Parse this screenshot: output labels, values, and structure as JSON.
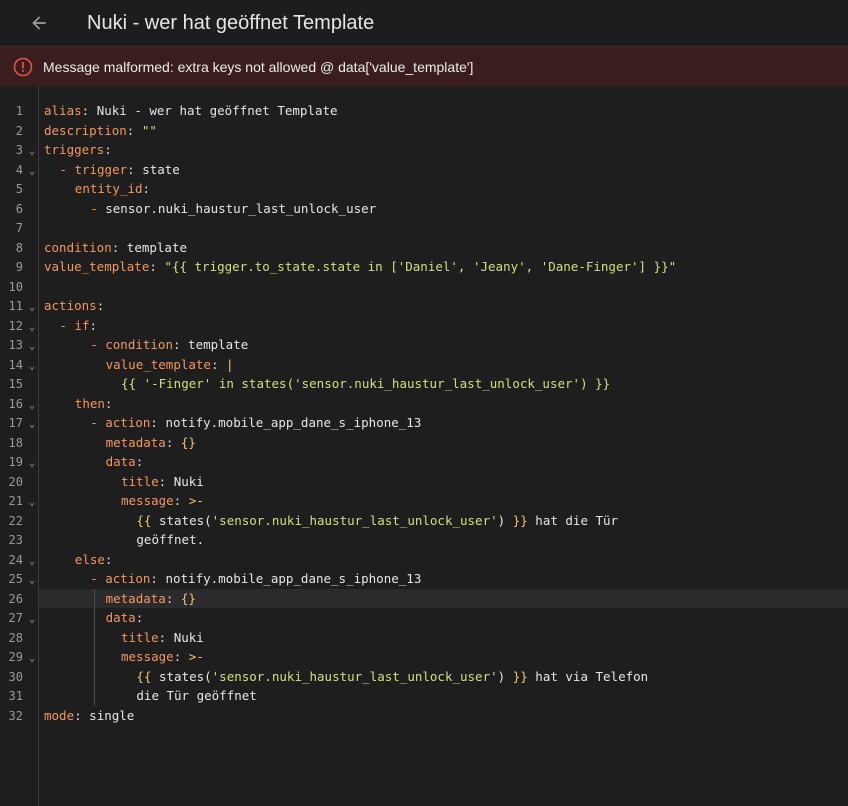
{
  "header": {
    "title": "Nuki - wer hat geöffnet Template",
    "back_icon": "arrow-left-icon"
  },
  "alert": {
    "icon": "error-circle-icon",
    "message": "Message malformed: extra keys not allowed @ data['value_template']",
    "color": "#e5533d"
  },
  "editor": {
    "active_line": 26,
    "lines": [
      {
        "n": "1",
        "fold": false,
        "indent": 0,
        "parts": [
          [
            "k",
            "alias"
          ],
          [
            "p",
            ": "
          ],
          [
            "v",
            "Nuki - wer hat geöffnet Template"
          ]
        ]
      },
      {
        "n": "2",
        "fold": false,
        "indent": 0,
        "parts": [
          [
            "k",
            "description"
          ],
          [
            "p",
            ": "
          ],
          [
            "s",
            "\"\""
          ]
        ]
      },
      {
        "n": "3",
        "fold": true,
        "indent": 0,
        "parts": [
          [
            "k",
            "triggers"
          ],
          [
            "p",
            ":"
          ]
        ]
      },
      {
        "n": "4",
        "fold": true,
        "indent": 2,
        "parts": [
          [
            "k",
            "- trigger"
          ],
          [
            "p",
            ": "
          ],
          [
            "v",
            "state"
          ]
        ]
      },
      {
        "n": "5",
        "fold": false,
        "indent": 4,
        "parts": [
          [
            "k",
            "entity_id"
          ],
          [
            "p",
            ":"
          ]
        ]
      },
      {
        "n": "6",
        "fold": false,
        "indent": 6,
        "parts": [
          [
            "k",
            "- "
          ],
          [
            "v",
            "sensor.nuki_haustur_last_unlock_user"
          ]
        ]
      },
      {
        "n": "7",
        "fold": false,
        "indent": 0,
        "parts": []
      },
      {
        "n": "8",
        "fold": false,
        "indent": 0,
        "parts": [
          [
            "k",
            "condition"
          ],
          [
            "p",
            ": "
          ],
          [
            "v",
            "template"
          ]
        ]
      },
      {
        "n": "9",
        "fold": false,
        "indent": 0,
        "parts": [
          [
            "k",
            "value_template"
          ],
          [
            "p",
            ": "
          ],
          [
            "s",
            "\"{{ trigger.to_state.state in ['Daniel', 'Jeany', 'Dane-Finger'] }}\""
          ]
        ]
      },
      {
        "n": "10",
        "fold": false,
        "indent": 0,
        "parts": []
      },
      {
        "n": "11",
        "fold": true,
        "indent": 0,
        "parts": [
          [
            "k",
            "actions"
          ],
          [
            "p",
            ":"
          ]
        ]
      },
      {
        "n": "12",
        "fold": true,
        "indent": 2,
        "parts": [
          [
            "k",
            "- if"
          ],
          [
            "p",
            ":"
          ]
        ]
      },
      {
        "n": "13",
        "fold": true,
        "indent": 6,
        "parts": [
          [
            "k",
            "- condition"
          ],
          [
            "p",
            ": "
          ],
          [
            "v",
            "template"
          ]
        ]
      },
      {
        "n": "14",
        "fold": true,
        "indent": 8,
        "parts": [
          [
            "k",
            "value_template"
          ],
          [
            "p",
            ": "
          ],
          [
            "y",
            "|"
          ]
        ]
      },
      {
        "n": "15",
        "fold": false,
        "indent": 10,
        "parts": [
          [
            "s",
            "{{ '-Finger' in states('sensor.nuki_haustur_last_unlock_user') }}"
          ]
        ]
      },
      {
        "n": "16",
        "fold": true,
        "indent": 4,
        "parts": [
          [
            "k",
            "then"
          ],
          [
            "p",
            ":"
          ]
        ]
      },
      {
        "n": "17",
        "fold": true,
        "indent": 6,
        "parts": [
          [
            "k",
            "- action"
          ],
          [
            "p",
            ": "
          ],
          [
            "v",
            "notify.mobile_app_dane_s_iphone_13"
          ]
        ]
      },
      {
        "n": "18",
        "fold": false,
        "indent": 8,
        "parts": [
          [
            "k",
            "metadata"
          ],
          [
            "p",
            ": "
          ],
          [
            "y",
            "{}"
          ]
        ]
      },
      {
        "n": "19",
        "fold": true,
        "indent": 8,
        "parts": [
          [
            "k",
            "data"
          ],
          [
            "p",
            ":"
          ]
        ]
      },
      {
        "n": "20",
        "fold": false,
        "indent": 10,
        "parts": [
          [
            "k",
            "title"
          ],
          [
            "p",
            ": "
          ],
          [
            "v",
            "Nuki"
          ]
        ]
      },
      {
        "n": "21",
        "fold": true,
        "indent": 10,
        "parts": [
          [
            "k",
            "message"
          ],
          [
            "p",
            ": "
          ],
          [
            "y",
            ">-"
          ]
        ]
      },
      {
        "n": "22",
        "fold": false,
        "indent": 12,
        "parts": [
          [
            "y",
            "{{ "
          ],
          [
            "v",
            "states("
          ],
          [
            "s",
            "'sensor.nuki_haustur_last_unlock_user'"
          ],
          [
            "v",
            ") "
          ],
          [
            "y",
            "}}"
          ],
          [
            "v",
            " hat die Tür"
          ]
        ]
      },
      {
        "n": "23",
        "fold": false,
        "indent": 12,
        "parts": [
          [
            "v",
            "geöffnet."
          ]
        ]
      },
      {
        "n": "24",
        "fold": true,
        "indent": 4,
        "parts": [
          [
            "k",
            "else"
          ],
          [
            "p",
            ":"
          ]
        ]
      },
      {
        "n": "25",
        "fold": true,
        "indent": 6,
        "parts": [
          [
            "k",
            "- action"
          ],
          [
            "p",
            ": "
          ],
          [
            "v",
            "notify.mobile_app_dane_s_iphone_13"
          ]
        ]
      },
      {
        "n": "26",
        "fold": false,
        "indent": 8,
        "parts": [
          [
            "k",
            "metadata"
          ],
          [
            "p",
            ": "
          ],
          [
            "y",
            "{}"
          ]
        ]
      },
      {
        "n": "27",
        "fold": true,
        "indent": 8,
        "parts": [
          [
            "k",
            "data"
          ],
          [
            "p",
            ":"
          ]
        ]
      },
      {
        "n": "28",
        "fold": false,
        "indent": 10,
        "parts": [
          [
            "k",
            "title"
          ],
          [
            "p",
            ": "
          ],
          [
            "v",
            "Nuki"
          ]
        ]
      },
      {
        "n": "29",
        "fold": true,
        "indent": 10,
        "parts": [
          [
            "k",
            "message"
          ],
          [
            "p",
            ": "
          ],
          [
            "y",
            ">-"
          ]
        ]
      },
      {
        "n": "30",
        "fold": false,
        "indent": 12,
        "parts": [
          [
            "y",
            "{{ "
          ],
          [
            "v",
            "states("
          ],
          [
            "s",
            "'sensor.nuki_haustur_last_unlock_user'"
          ],
          [
            "v",
            ") "
          ],
          [
            "y",
            "}}"
          ],
          [
            "v",
            " hat via Telefon"
          ]
        ]
      },
      {
        "n": "31",
        "fold": false,
        "indent": 12,
        "parts": [
          [
            "v",
            "die Tür geöffnet"
          ]
        ]
      },
      {
        "n": "32",
        "fold": false,
        "indent": 0,
        "parts": [
          [
            "k",
            "mode"
          ],
          [
            "p",
            ": "
          ],
          [
            "v",
            "single"
          ]
        ]
      }
    ]
  }
}
